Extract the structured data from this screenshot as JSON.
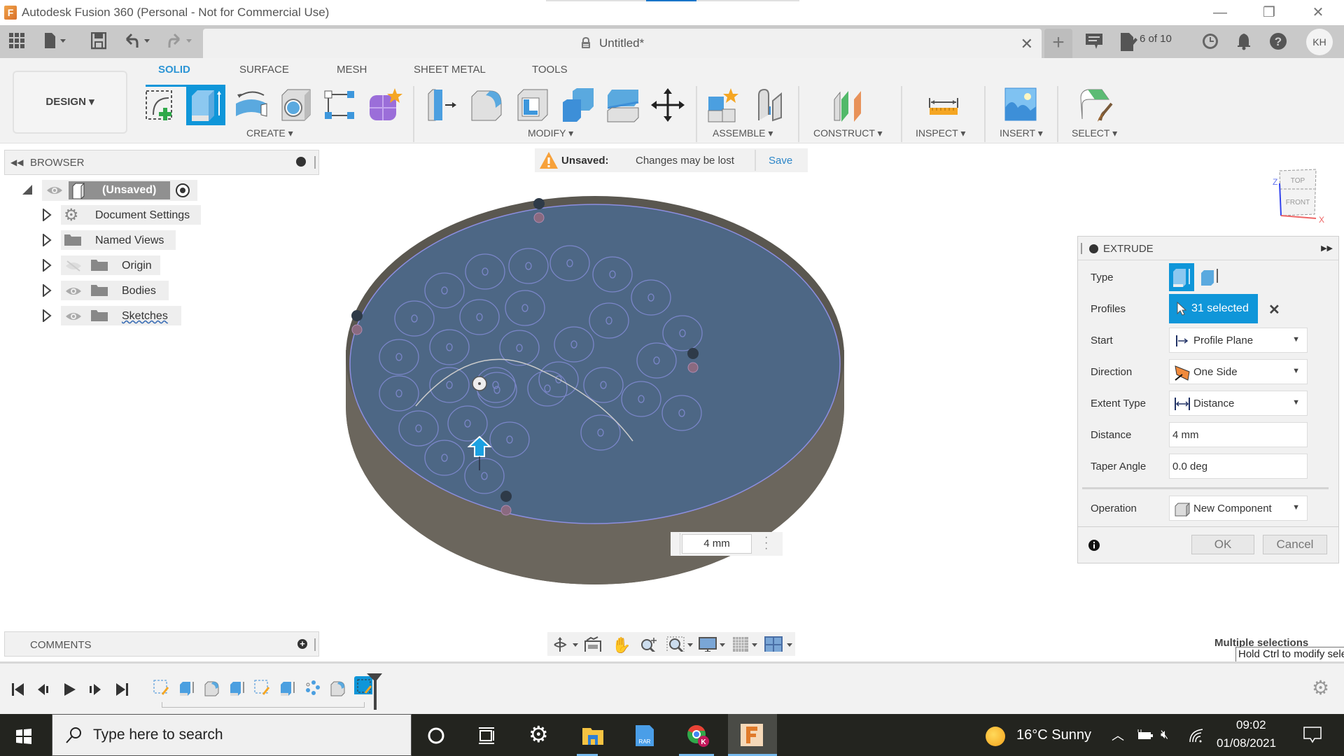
{
  "window": {
    "title": "Autodesk Fusion 360 (Personal - Not for Commercial Use)",
    "app_icon_letter": "F",
    "controls": {
      "minimize": "—",
      "restore": "❐",
      "close": "✕"
    }
  },
  "app_toolbar": {
    "document_tab": {
      "name": "Untitled*",
      "close": "✕"
    },
    "new_tab": "+",
    "job_status": "6 of 10",
    "avatar_initials": "KH"
  },
  "ribbon": {
    "workspace": "DESIGN ▾",
    "tabs": [
      {
        "label": "SOLID",
        "active": true
      },
      {
        "label": "SURFACE",
        "active": false
      },
      {
        "label": "MESH",
        "active": false
      },
      {
        "label": "SHEET METAL",
        "active": false
      },
      {
        "label": "TOOLS",
        "active": false
      }
    ],
    "groups": [
      {
        "label": "CREATE ▾",
        "tools": [
          "create-sketch",
          "extrude",
          "revolve",
          "hole",
          "pattern",
          "form"
        ]
      },
      {
        "label": "MODIFY ▾",
        "tools": [
          "press-pull",
          "fillet",
          "shell",
          "combine",
          "split-body",
          "move-copy"
        ]
      },
      {
        "label": "ASSEMBLE ▾",
        "tools": [
          "new-component",
          "joint"
        ]
      },
      {
        "label": "CONSTRUCT ▾",
        "tools": [
          "offset-plane"
        ]
      },
      {
        "label": "INSPECT ▾",
        "tools": [
          "measure"
        ]
      },
      {
        "label": "INSERT ▾",
        "tools": [
          "insert-image"
        ]
      },
      {
        "label": "SELECT ▾",
        "tools": [
          "select"
        ]
      }
    ]
  },
  "browser": {
    "title": "BROWSER",
    "root": "(Unsaved)",
    "items": [
      {
        "label": "Document Settings",
        "icon": "gear"
      },
      {
        "label": "Named Views",
        "icon": "folder"
      },
      {
        "label": "Origin",
        "icon": "folder",
        "visible": false
      },
      {
        "label": "Bodies",
        "icon": "folder",
        "visible": true
      },
      {
        "label": "Sketches",
        "icon": "folder",
        "visible": true
      }
    ]
  },
  "banner": {
    "label": "Unsaved:",
    "message": "Changes may be lost",
    "action": "Save"
  },
  "viewcube": {
    "top": "TOP",
    "front": "FRONT",
    "axis_z": "Z",
    "axis_x": "X"
  },
  "viewport": {
    "distance_input": "4 mm",
    "profile_count": 31,
    "colors": {
      "body": "#6b665d",
      "face": "#4d6785",
      "profile": "#7b86c9"
    }
  },
  "extrude": {
    "title": "EXTRUDE",
    "rows": {
      "type_label": "Type",
      "profiles_label": "Profiles",
      "profiles_value": "31 selected",
      "start_label": "Start",
      "start_value": "Profile Plane",
      "direction_label": "Direction",
      "direction_value": "One Side",
      "extent_label": "Extent Type",
      "extent_value": "Distance",
      "distance_label": "Distance",
      "distance_value": "4 mm",
      "taper_label": "Taper Angle",
      "taper_value": "0.0 deg",
      "operation_label": "Operation",
      "operation_value": "New Component"
    },
    "ok": "OK",
    "cancel": "Cancel"
  },
  "comments": {
    "title": "COMMENTS"
  },
  "status": {
    "multiple_selections": "Multiple selections",
    "tooltip": "Hold Ctrl to modify selection"
  },
  "taskbar": {
    "search_placeholder": "Type here to search",
    "weather": "16°C  Sunny",
    "time": "09:02",
    "date": "01/08/2021"
  }
}
